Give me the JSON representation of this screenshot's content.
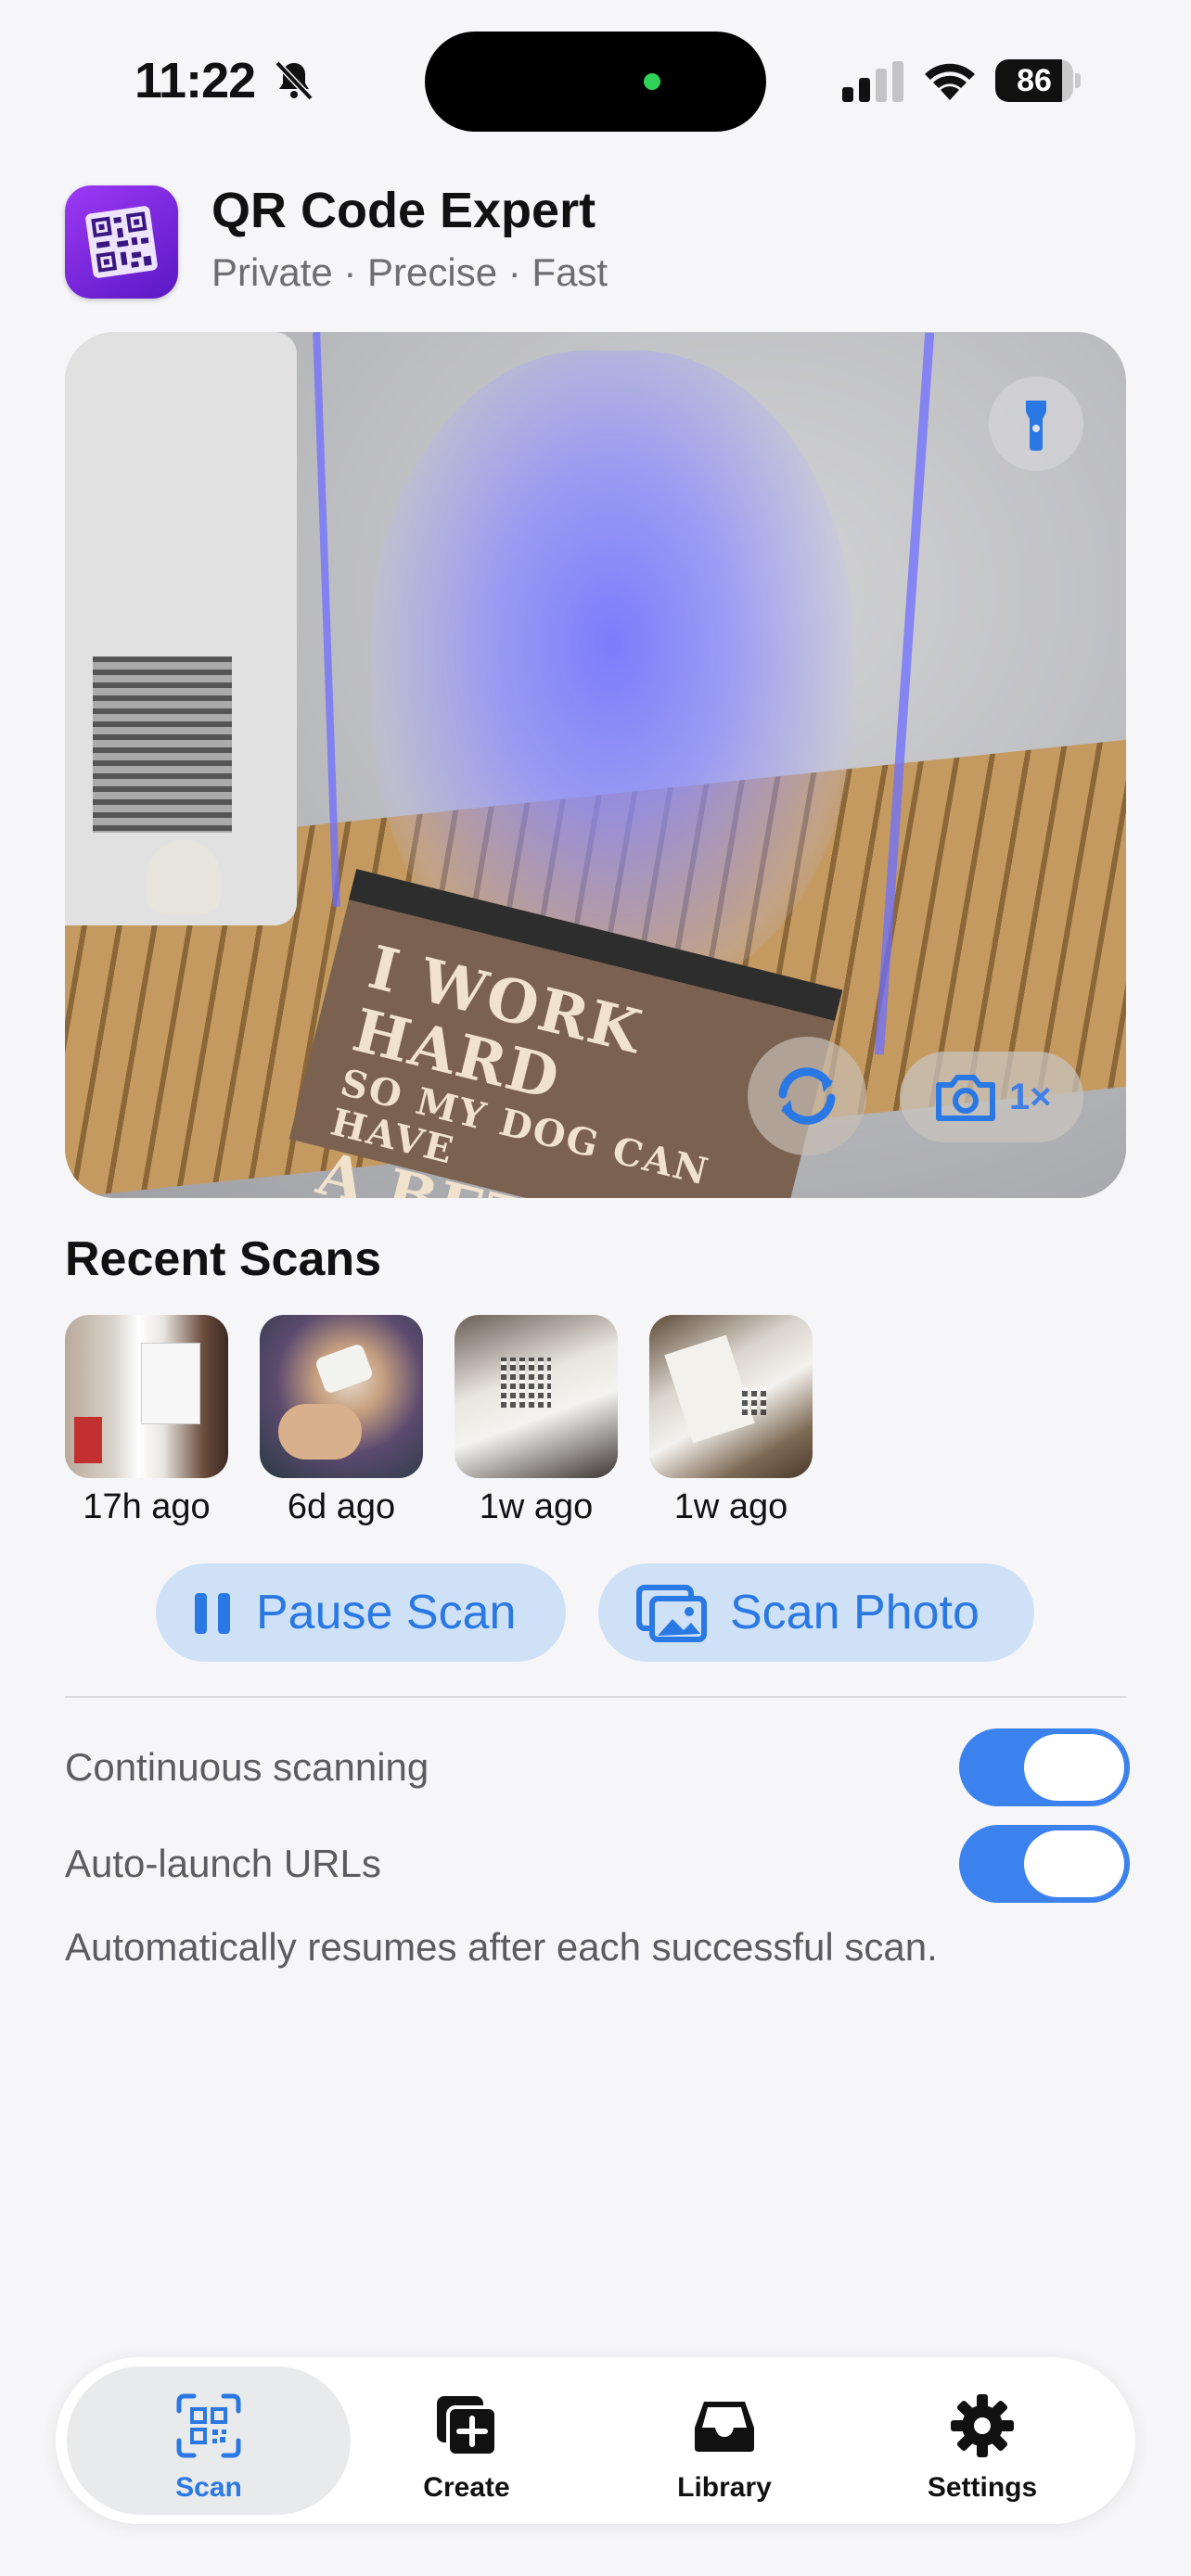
{
  "status_bar": {
    "time": "11:22",
    "battery": "86",
    "battery_level": 0.86,
    "icons": [
      "bell-slash-icon",
      "cellular-signal-icon",
      "wifi-icon",
      "battery-icon"
    ]
  },
  "header": {
    "title": "QR Code Expert",
    "subtitle": "Private · Precise · Fast",
    "icon": "app-qr-icon"
  },
  "camera": {
    "sign_lines": [
      "I WORK HARD",
      "SO MY DOG CAN HAVE",
      "A BETTER LIFE"
    ],
    "flashlight_icon": "flashlight-icon",
    "flip_icon": "camera-flip-icon",
    "zoom_label": "1×",
    "zoom_icon": "camera-icon"
  },
  "recent_scans": {
    "title": "Recent Scans",
    "items": [
      {
        "label": "17h ago"
      },
      {
        "label": "6d ago"
      },
      {
        "label": "1w ago"
      },
      {
        "label": "1w ago"
      }
    ]
  },
  "actions": {
    "pause_label": "Pause Scan",
    "photo_label": "Scan Photo"
  },
  "settings": {
    "continuous_label": "Continuous scanning",
    "continuous_on": true,
    "autolaunch_label": "Auto-launch URLs",
    "autolaunch_on": true,
    "note": "Automatically resumes after each successful scan."
  },
  "tabbar": {
    "tabs": [
      {
        "label": "Scan",
        "icon": "qr-scan-icon",
        "active": true
      },
      {
        "label": "Create",
        "icon": "plus-square-icon",
        "active": false
      },
      {
        "label": "Library",
        "icon": "tray-icon",
        "active": false
      },
      {
        "label": "Settings",
        "icon": "gear-icon",
        "active": false
      }
    ]
  },
  "colors": {
    "accent": "#2a78e4",
    "toggle_on": "#3c82ee",
    "button_bg": "#cfe1f7",
    "app_icon": "#7b2ee0"
  }
}
